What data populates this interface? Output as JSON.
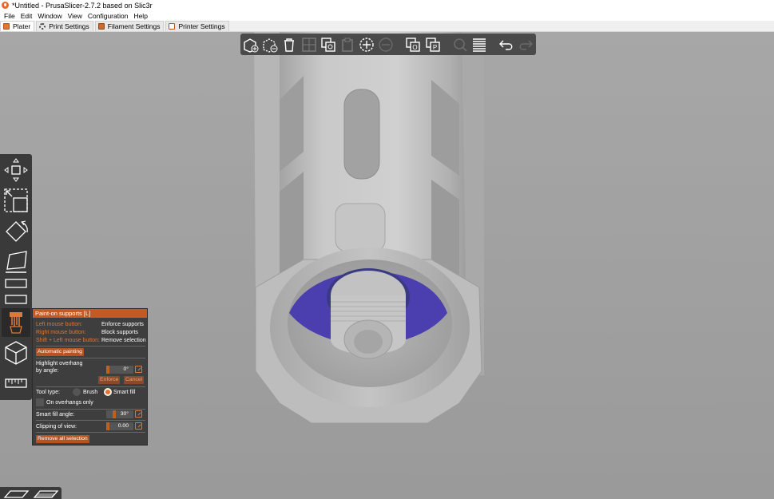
{
  "window": {
    "title": "*Untitled - PrusaSlicer-2.7.2 based on Slic3r"
  },
  "menu": [
    "File",
    "Edit",
    "Window",
    "View",
    "Configuration",
    "Help"
  ],
  "tabs": [
    {
      "label": "Plater",
      "icon": "plater-icon"
    },
    {
      "label": "Print Settings",
      "icon": "gear-icon"
    },
    {
      "label": "Filament Settings",
      "icon": "filament-spool-icon"
    },
    {
      "label": "Printer Settings",
      "icon": "printer-icon"
    }
  ],
  "top_toolbar": [
    {
      "name": "add-icon",
      "state": "enabled"
    },
    {
      "name": "delete-icon",
      "state": "enabled"
    },
    {
      "name": "delete-all-icon",
      "state": "enabled"
    },
    {
      "name": "arrange-icon",
      "state": "disabled"
    },
    {
      "name": "copy-icon",
      "state": "enabled"
    },
    {
      "name": "paste-icon",
      "state": "disabled"
    },
    {
      "name": "add-instance-icon",
      "state": "enabled"
    },
    {
      "name": "remove-instance-icon",
      "state": "disabled"
    },
    {
      "name": "split-objects-icon",
      "state": "enabled"
    },
    {
      "name": "split-parts-icon",
      "state": "enabled"
    },
    {
      "name": "search-icon",
      "state": "disabled"
    },
    {
      "name": "layers-editing-icon",
      "state": "enabled"
    },
    {
      "name": "undo-icon",
      "state": "enabled"
    },
    {
      "name": "redo-icon",
      "state": "disabled"
    }
  ],
  "left_toolbar": [
    "move-icon",
    "scale-icon",
    "rotate-icon",
    "place-on-face-icon",
    "cut-icon",
    "hollow-icon",
    "paint-supports-icon",
    "seam-painting-icon",
    "measure-icon"
  ],
  "paint_panel": {
    "title": "Paint-on supports [L]",
    "left_mouse_label": "Left mouse button:",
    "left_mouse_action": "Enforce supports",
    "right_mouse_label": "Right mouse button:",
    "right_mouse_action": "Block supports",
    "shift_label": "Shift + Left mouse button:",
    "shift_action": "Remove selection",
    "automatic_painting": "Automatic painting",
    "highlight_label_1": "Highlight overhang",
    "highlight_label_2": "by angle:",
    "highlight_value": "0°",
    "enforce_button": "Enforce",
    "cancel_button": "Cancel",
    "tool_type_label": "Tool type:",
    "tool_brush": "Brush",
    "tool_smart_fill": "Smart fill",
    "tool_selected": "Smart fill",
    "on_overhangs_only": "On overhangs only",
    "on_overhangs_checked": false,
    "smart_fill_label": "Smart fill angle:",
    "smart_fill_value": "30°",
    "clipping_label": "Clipping of view:",
    "clipping_value": "0.00",
    "remove_all": "Remove all selection"
  },
  "colors": {
    "accent": "#e07434",
    "panel_bg": "#3e3e3e",
    "toolbar_bg": "#4a4a4a",
    "model": "#c8c8c8",
    "painted_region": "#4b3fb0",
    "viewport_bg": "#a0a0a0"
  },
  "view_buttons": [
    "view-3d-icon",
    "view-preview-icon"
  ]
}
